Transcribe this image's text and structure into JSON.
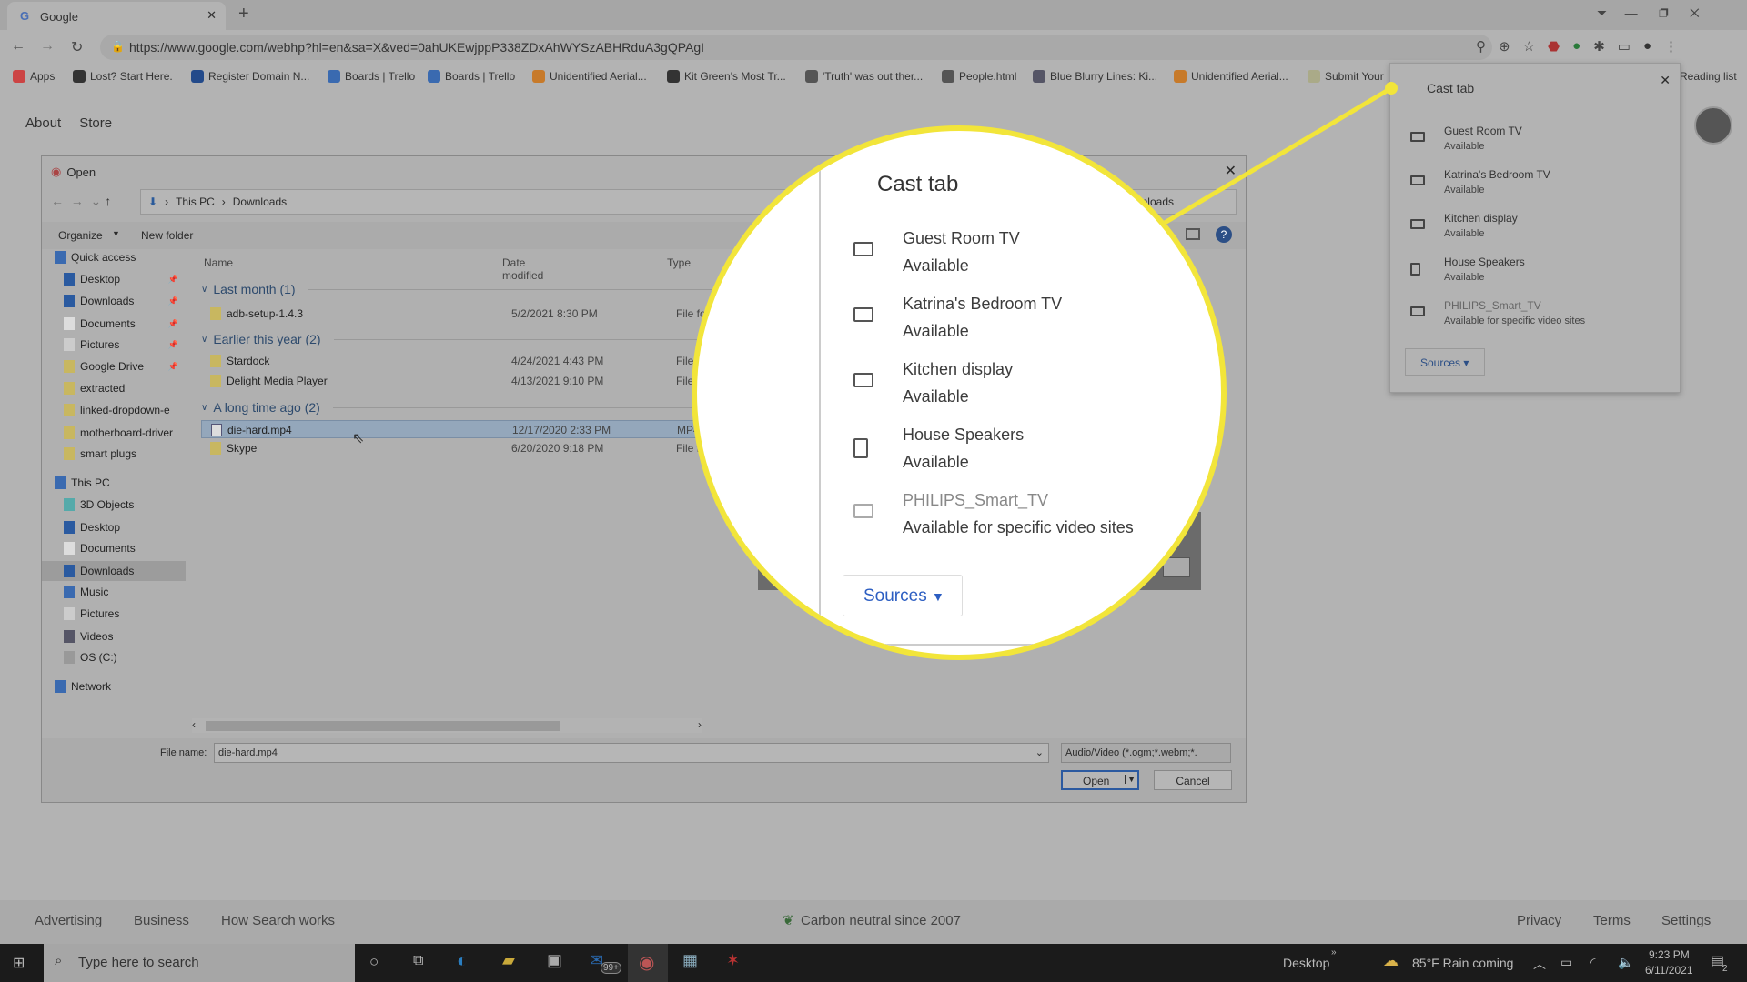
{
  "browser": {
    "tab_title": "Google",
    "url": "https://www.google.com/webhp?hl=en&sa=X&ved=0ahUKEwjppP338ZDxAhWYSzABHRduA3gQPAgI",
    "bookmarks": [
      "Apps",
      "Lost? Start Here.",
      "Register Domain N...",
      "Boards | Trello",
      "Boards | Trello",
      "Unidentified Aerial...",
      "Kit Green's Most Tr...",
      "'Truth' was out ther...",
      "People.html",
      "Blue Blurry Lines: Ki...",
      "Unidentified Aerial...",
      "Submit Your"
    ],
    "reading_list": "Reading list"
  },
  "page": {
    "nav": [
      "About",
      "Store"
    ],
    "footer_left": [
      "Advertising",
      "Business",
      "How Search works"
    ],
    "carbon": "Carbon neutral since 2007",
    "footer_right": [
      "Privacy",
      "Terms",
      "Settings"
    ]
  },
  "dialog": {
    "title": "Open",
    "breadcrumb": [
      "This PC",
      "Downloads"
    ],
    "organize": "Organize",
    "new_folder": "New folder",
    "columns": [
      "Name",
      "Date modified",
      "Type"
    ],
    "nav": [
      "Quick access",
      "Desktop",
      "Downloads",
      "Documents",
      "Pictures",
      "Google Drive",
      "extracted",
      "linked-dropdown-e",
      "motherboard-driver",
      "smart plugs",
      "This PC",
      "3D Objects",
      "Desktop",
      "Documents",
      "Downloads",
      "Music",
      "Pictures",
      "Videos",
      "OS (C:)",
      "Network"
    ],
    "groups": [
      "Last month (1)",
      "Earlier this year (2)",
      "A long time ago (2)"
    ],
    "files": [
      {
        "name": "adb-setup-1.4.3",
        "date": "5/2/2021 8:30 PM",
        "type": "File fold"
      },
      {
        "name": "Stardock",
        "date": "4/24/2021 4:43 PM",
        "type": "File fo"
      },
      {
        "name": "Delight Media Player",
        "date": "4/13/2021 9:10 PM",
        "type": "File fo"
      },
      {
        "name": "die-hard.mp4",
        "date": "12/17/2020 2:33 PM",
        "type": "MP4"
      },
      {
        "name": "Skype",
        "date": "6/20/2020 9:18 PM",
        "type": "File fo"
      }
    ],
    "file_name_label": "File name:",
    "file_name": "die-hard.mp4",
    "filter": "Audio/Video (*.ogm;*.webm;*.",
    "open": "Open",
    "cancel": "Cancel",
    "address_tail": "nloads"
  },
  "cast": {
    "title": "Cast tab",
    "sources": "Sources",
    "devices": [
      {
        "name": "Guest Room TV",
        "status": "Available",
        "icon": "tv-icon"
      },
      {
        "name": "Katrina's Bedroom TV",
        "status": "Available",
        "icon": "tv-icon"
      },
      {
        "name": "Kitchen display",
        "status": "Available",
        "icon": "tv-icon"
      },
      {
        "name": "House Speakers",
        "status": "Available",
        "icon": "speaker-group-icon"
      },
      {
        "name": "PHILIPS_Smart_TV",
        "status": "Available for specific video sites",
        "icon": "tv-icon"
      }
    ]
  },
  "taskbar": {
    "search": "Type here to search",
    "mail_badge": "99+",
    "desktop": "Desktop",
    "weather": "85°F  Rain coming",
    "time": "9:23 PM",
    "date": "6/11/2021",
    "notif": "2"
  },
  "colors": {
    "highlight": "#f2e53a",
    "selection": "#94a7bb"
  }
}
